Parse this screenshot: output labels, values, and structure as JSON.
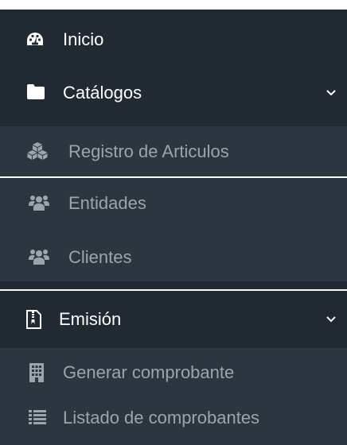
{
  "menu": {
    "inicio": {
      "label": "Inicio",
      "icon": "tachometer-icon"
    },
    "catalogos": {
      "label": "Catálogos",
      "icon": "folder-icon",
      "items": [
        {
          "label": "Registro de Articulos",
          "icon": "cubes-icon"
        },
        {
          "label": "Entidades",
          "icon": "users-icon"
        },
        {
          "label": "Clientes",
          "icon": "users-icon"
        }
      ]
    },
    "emision": {
      "label": "Emisión",
      "icon": "file-archive-icon",
      "items": [
        {
          "label": "Generar comprobante",
          "icon": "building-icon"
        },
        {
          "label": "Listado de comprobantes",
          "icon": "list-icon"
        }
      ]
    }
  },
  "colors": {
    "header_bg": "#212a33",
    "submenu_bg": "#2b3640",
    "top_text": "#ffffff",
    "sub_text": "#98a6ad"
  }
}
